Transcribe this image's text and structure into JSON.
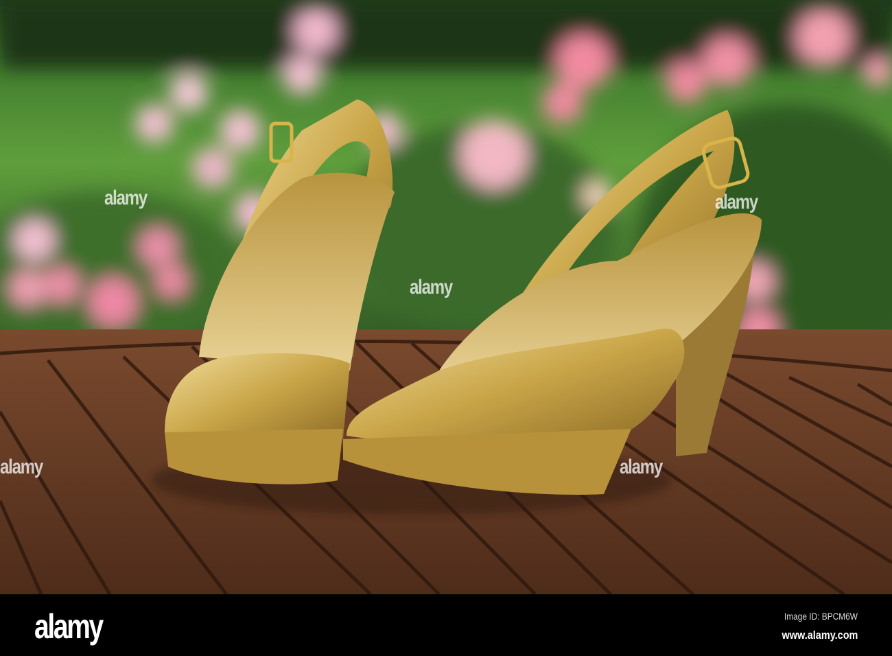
{
  "photo": {
    "subject": "gold high-heel slingback shoes on wooden garden table",
    "colors": {
      "lawn": "#5a9a3a",
      "foliage": "#2f5a25",
      "rose": "#e88aa0",
      "wood": "#6b3f26",
      "gold": "#c9a548"
    }
  },
  "watermark": {
    "text": "alamy"
  },
  "footer": {
    "logo": "alamy",
    "image_id": "Image ID: BPCM6W",
    "url": "www.alamy.com"
  }
}
